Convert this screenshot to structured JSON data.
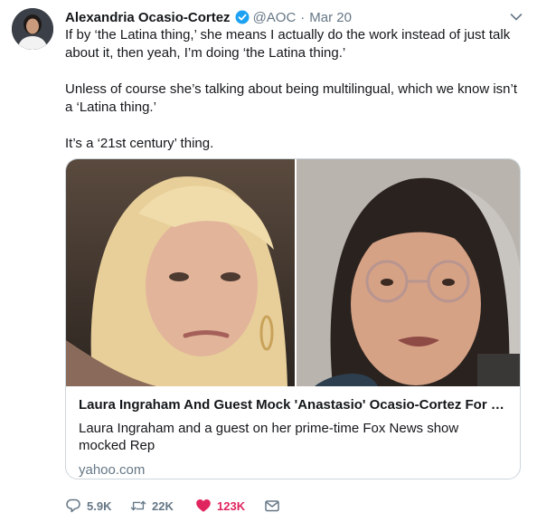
{
  "tweet": {
    "author_name": "Alexandria Ocasio-Cortez",
    "handle": "@AOC",
    "separator": "·",
    "date": "Mar 20",
    "paragraphs": [
      "If by ‘the Latina thing,’ she means I actually do the work instead of just talk about it, then yeah, I’m doing ‘the Latina thing.’",
      "Unless of course she’s talking about being multilingual, which we know isn’t a ‘Latina thing.’",
      "It’s a ‘21st century’ thing."
    ]
  },
  "card": {
    "title": "Laura Ingraham And Guest Mock 'Anastasio' Ocasio-Cortez For Doin...",
    "description": "Laura Ingraham and a guest on her prime-time Fox News show mocked Rep",
    "domain": "yahoo.com"
  },
  "actions": {
    "reply_count": "5.9K",
    "retweet_count": "22K",
    "like_count": "123K"
  },
  "icons": {
    "verified": "verified-badge-icon",
    "caret": "chevron-down-icon",
    "reply": "reply-icon",
    "retweet": "retweet-icon",
    "like": "heart-icon",
    "dm": "envelope-icon"
  },
  "colors": {
    "accent": "#1da1f2",
    "like": "#e0245e",
    "secondary_text": "#657786",
    "border": "#ccd6dd"
  }
}
